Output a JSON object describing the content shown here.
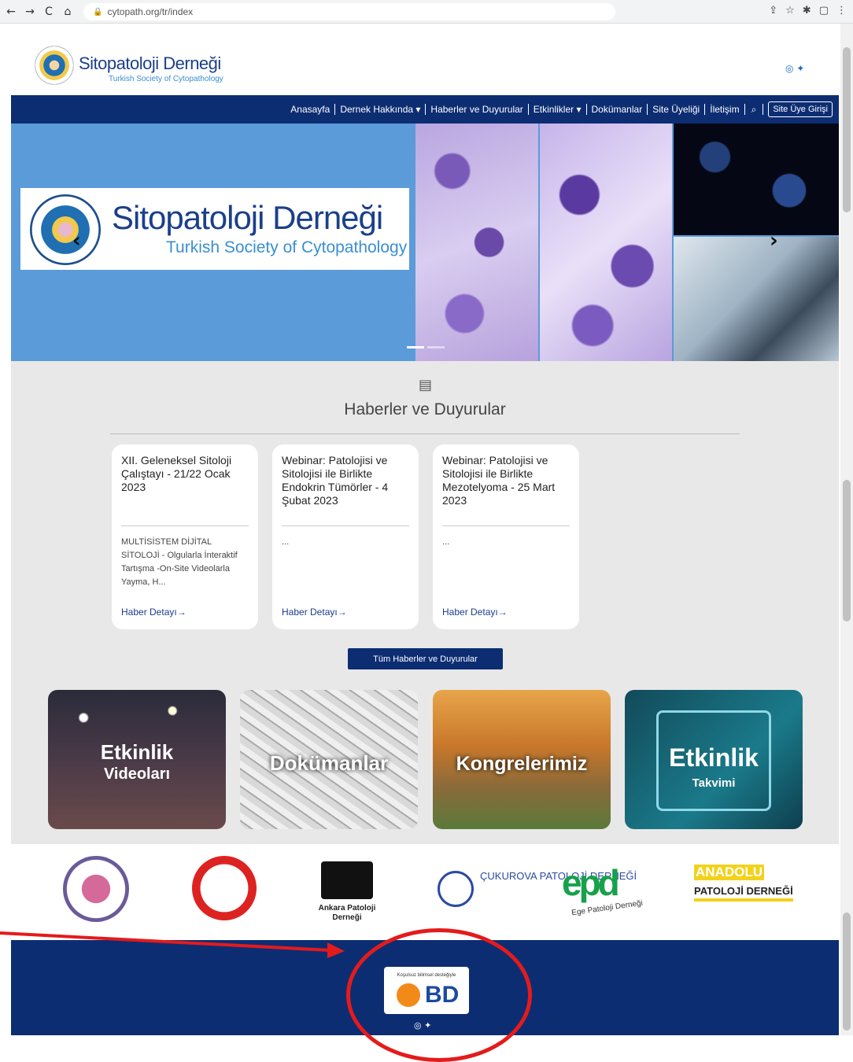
{
  "browser": {
    "url": "cytopath.org/tr/index",
    "nav": [
      "←",
      "→",
      "C",
      "⌂"
    ]
  },
  "header": {
    "logo_title": "Sitopatoloji Derneği",
    "logo_subtitle": "Turkish Society of Cytopathology",
    "social": "◎ ✦"
  },
  "navbar": {
    "items": [
      "Anasayfa",
      "Dernek Hakkında ▾",
      "Haberler ve Duyurular",
      "Etkinlikler ▾",
      "Dokümanlar",
      "Site Üyeliği",
      "İletişim"
    ],
    "search_icon": "⌕",
    "login": "Site Üye Girişi"
  },
  "hero": {
    "title": "Sitopatoloji Derneği",
    "subtitle": "Turkish Society of Cytopathology",
    "prev": "‹",
    "next": "›"
  },
  "news": {
    "section_title": "Haberler ve Duyurular",
    "cards": [
      {
        "title": "XII. Geleneksel Sitoloji Çalıştayı - 21/22 Ocak 2023",
        "desc": "MULTİSİSTEM DİJİTAL SİTOLOJİ - Olgularla İnteraktif Tartışma -On-Site Videolarla Yayma, H...",
        "link": "Haber Detayı→"
      },
      {
        "title": "Webinar: Patolojisi ve Sitolojisi ile Birlikte Endokrin Tümörler - 4 Şubat 2023",
        "desc": "...",
        "link": "Haber Detayı→"
      },
      {
        "title": "Webinar: Patolojisi ve Sitolojisi ile Birlikte Mezotelyoma - 25 Mart 2023",
        "desc": "...",
        "link": "Haber Detayı→"
      }
    ],
    "all_button": "Tüm Haberler ve Duyurular"
  },
  "tiles": {
    "t1_line1": "Etkinlik",
    "t1_line2": "Videoları",
    "t2": "Dokümanlar",
    "t3": "Kongrelerimiz",
    "t4_line1": "Etkinlik",
    "t4_line2": "Takvimi"
  },
  "partners": {
    "p3": "Ankara Patoloji Derneği",
    "p4": "ÇUKUROVA PATOLOJİ DERNEĞİ",
    "p5": "epd",
    "p5_sub": "Ege Patoloji Derneği",
    "p6_top": "ANADOLU",
    "p6_bottom": "PATOLOJİ DERNEĞİ"
  },
  "footer": {
    "bd_note": "Koşulsuz bilimsel desteğiyle",
    "bd_logo": "BD",
    "social": "◎ ✦"
  }
}
